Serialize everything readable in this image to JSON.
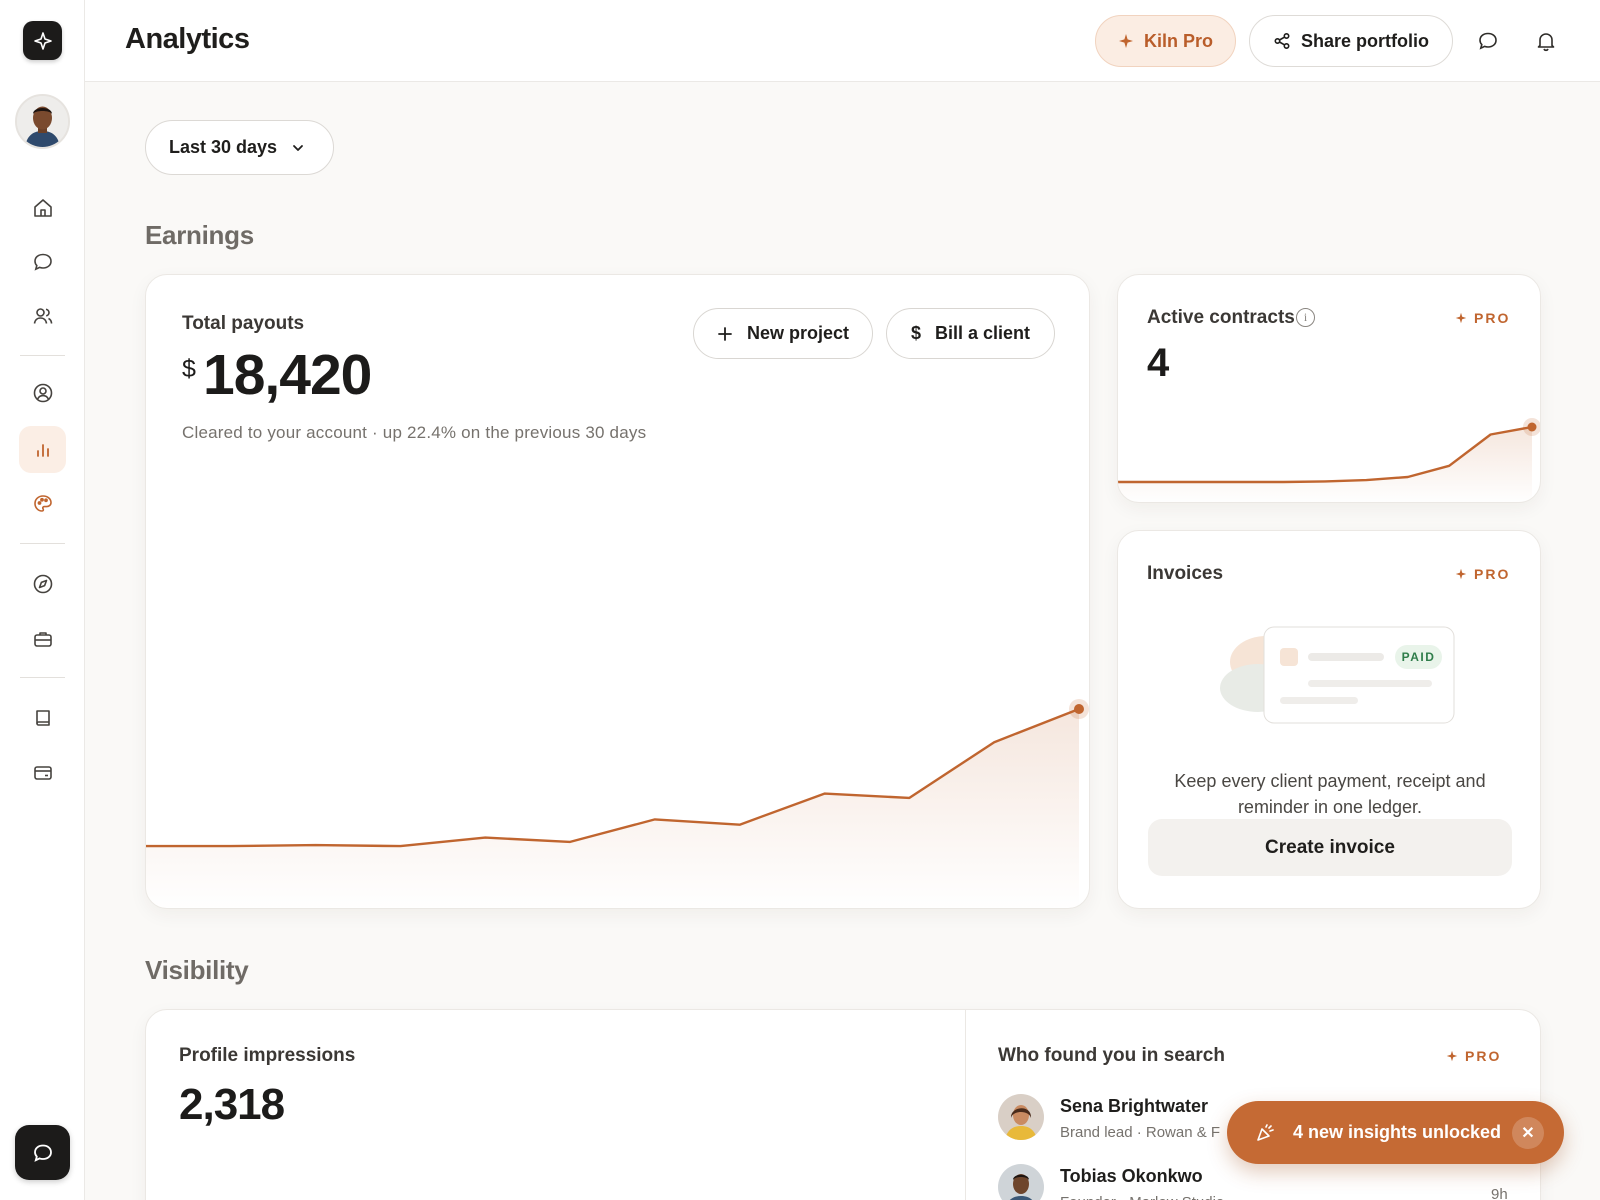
{
  "header": {
    "title": "Analytics",
    "kiln_pro_label": "Kiln Pro",
    "share_label": "Share portfolio"
  },
  "filter": {
    "range_label": "Last 30 days"
  },
  "earnings": {
    "section_title": "Earnings",
    "total_payouts": {
      "title": "Total payouts",
      "currency": "$",
      "amount": "18,420",
      "subtitle": "Cleared to your account · up 22.4% on the previous 30 days",
      "new_project_label": "New project",
      "bill_client_label": "Bill a client",
      "trend": [
        12,
        12,
        13,
        12,
        20,
        16,
        37,
        32,
        61,
        57,
        109,
        140
      ]
    },
    "active_contracts": {
      "title": "Active contracts",
      "pro_label": "PRO",
      "value": "4",
      "trend": [
        0,
        0,
        0,
        0,
        0,
        0.5,
        1.5,
        4,
        13,
        38,
        44
      ]
    },
    "invoices": {
      "title": "Invoices",
      "pro_label": "PRO",
      "badge": "PAID",
      "description": "Keep every client payment, receipt and reminder in one ledger.",
      "create_label": "Create invoice"
    }
  },
  "visibility": {
    "section_title": "Visibility",
    "impressions": {
      "title": "Profile impressions",
      "value": "2,318"
    },
    "search": {
      "title": "Who found you in search",
      "pro_label": "PRO",
      "people": [
        {
          "name": "Sena Brightwater",
          "role": "Brand lead · Rowan & F",
          "time": ""
        },
        {
          "name": "Tobias Okonkwo",
          "role": "Founder · Marlow Studio",
          "time": "9h"
        }
      ]
    }
  },
  "toast": {
    "label": "4 new insights unlocked"
  },
  "icons": {
    "logo": "sparkle-icon",
    "nav": [
      "home-icon",
      "chat-icon",
      "users-icon",
      "profile-icon",
      "bar-chart-icon",
      "palette-icon",
      "compass-icon",
      "briefcase-icon",
      "book-icon",
      "wallet-icon"
    ]
  },
  "colors": {
    "accent": "#c0652f",
    "accent_bg": "#fbede3",
    "paid_green": "#2f7d4a"
  }
}
